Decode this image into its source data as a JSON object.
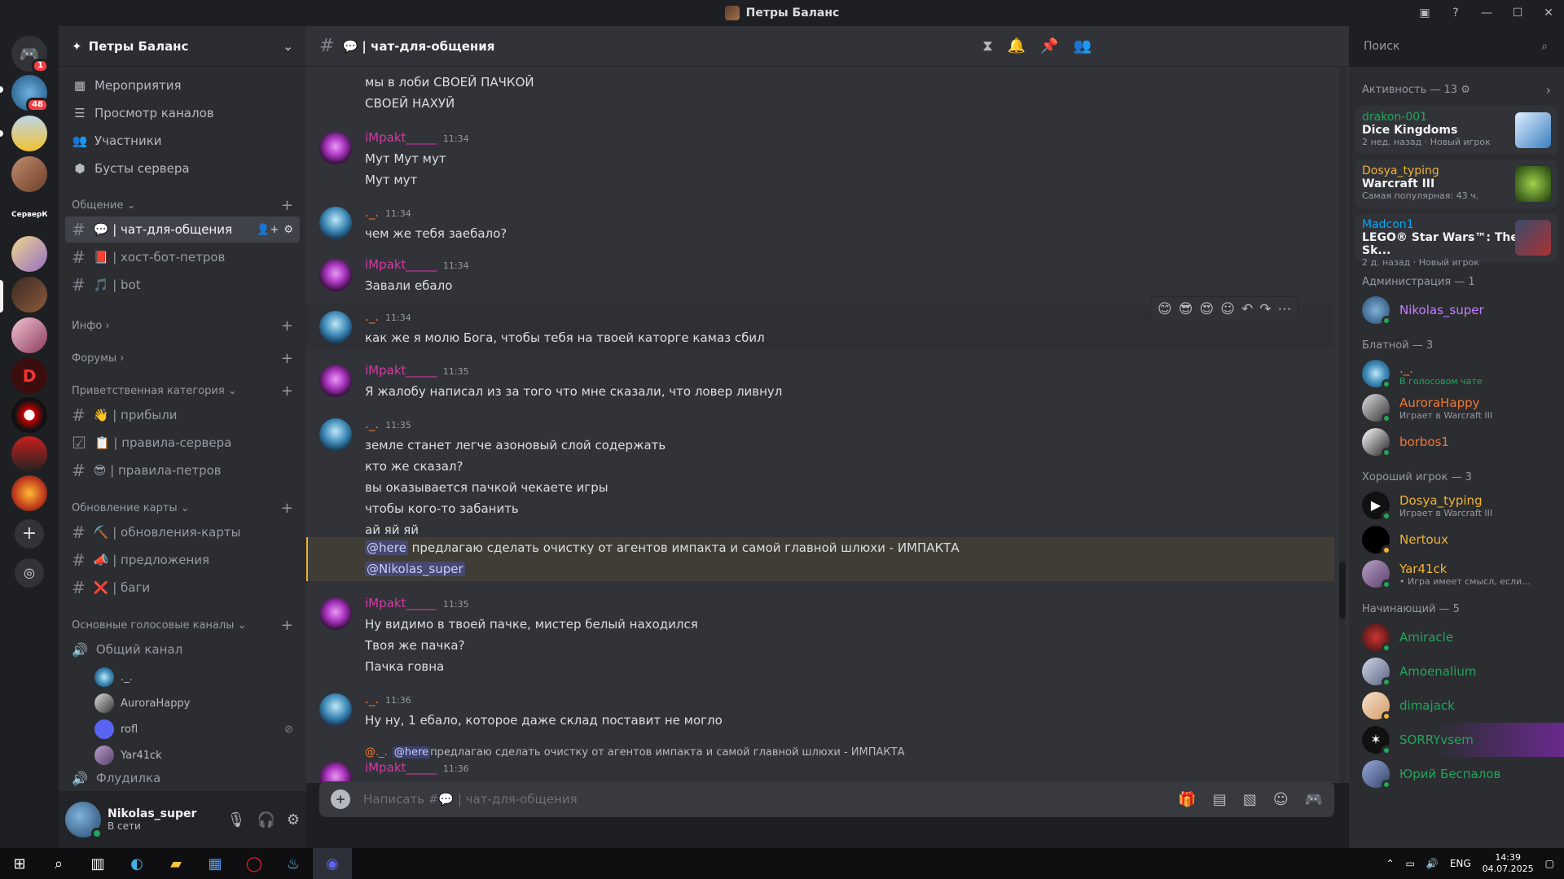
{
  "window": {
    "title": "Петры Баланс"
  },
  "guilds": {
    "home_badge": "1",
    "second_badge": "48",
    "server_text": "СерверК"
  },
  "server": {
    "name": "Петры Баланс",
    "nav": [
      "Мероприятия",
      "Просмотр каналов",
      "Участники",
      "Бусты сервера"
    ],
    "categories": {
      "obshenie": "Общение",
      "info": "Инфо",
      "forums": "Форумы",
      "welcome": "Приветственная категория",
      "update": "Обновление карты",
      "voice": "Основные голосовые каналы",
      "cut": "Флудилка"
    },
    "channels": {
      "chat": "💬 | чат-для-общения",
      "host": "📕 | хост-бот-петров",
      "bot": "🎵 | bot",
      "arrive": "👋 | прибыли",
      "rules_srv": "📋 | правила-сервера",
      "rules_pet": "😎 | правила-петров",
      "map_upd": "⛏️ | обновления-карты",
      "suggest": "📣 | предложения",
      "bugs": "❌ | баги",
      "voice_main": "Общий канал"
    },
    "voice_users": [
      "._.",
      "AuroraHappy",
      "rofl",
      "Yar41ck"
    ]
  },
  "user": {
    "name": "Nikolas_super",
    "status": "В сети"
  },
  "chat": {
    "header": "💬 | чат-для-общения",
    "search_placeholder": "Поиск",
    "composer_placeholder": "Написать #💬 | чат-для-общения",
    "messages": [
      {
        "lines": [
          "мы в лоби СВОЕЙ ПАЧКОЙ",
          "СВОЕЙ НАХУЙ"
        ]
      },
      {
        "user": "iMpakt_____",
        "time": "11:34",
        "lines": [
          "Мут Мут мут",
          "Мут мут"
        ]
      },
      {
        "user": "._.",
        "time": "11:34",
        "lines": [
          "чем же тебя заебало?"
        ]
      },
      {
        "user": "iMpakt_____",
        "time": "11:34",
        "lines": [
          "Завали ебало"
        ]
      },
      {
        "user": "._.",
        "time": "11:34",
        "lines": [
          "как же я молю Бога, чтобы тебя на твоей каторге камаз сбил"
        ]
      },
      {
        "user": "iMpakt_____",
        "time": "11:35",
        "lines": [
          "Я жалобу написал из за того что мне сказали, что ловер ливнул"
        ]
      },
      {
        "user": "._.",
        "time": "11:35",
        "lines": [
          "земле станет легче азоновый слой содержать",
          "кто же сказал?",
          "вы оказывается пачкой чекаете игры",
          "чтобы кого-то забанить",
          "ай яй яй"
        ]
      },
      {
        "mention1": "@here",
        "text1": " предлагаю сделать очистку от агентов импакта и самой главной шлюхи - ИМПАКТА",
        "mention2": "@Nikolas_super"
      },
      {
        "user": "iMpakt_____",
        "time": "11:35",
        "lines": [
          "Ну видимо в твоей пачке, мистер белый находился",
          "Твоя же пачка?",
          "Пачка говна"
        ]
      },
      {
        "user": "._.",
        "time": "11:36",
        "lines": [
          "Ну ну, 1 ебало, которое даже склад поставит не могло"
        ]
      },
      {
        "reply_user": "@._.",
        "reply_mention": "@here",
        "reply_text": " предлагаю сделать очистку от агентов импакта и самой главной шлюхи - ИМПАКТА",
        "user": "iMpakt_____",
        "time": "11:36"
      }
    ]
  },
  "members": {
    "activity_title": "Активность — 13",
    "activities": [
      {
        "user": "drakon-001",
        "game": "Dice Kingdoms",
        "meta": "2 нед. назад",
        "tag": "Новый игрок"
      },
      {
        "user": "Dosya_typing",
        "game": "Warcraft III",
        "meta": "Самая популярная: 43 ч."
      },
      {
        "user": "Madcon1",
        "game": "LEGO® Star Wars™: The Sk...",
        "meta": "2 д. назад",
        "tag": "Новый игрок"
      }
    ],
    "groups": [
      {
        "title": "Администрация — 1",
        "users": [
          {
            "name": "Nikolas_super",
            "color": "#c77dff"
          }
        ]
      },
      {
        "title": "Блатной — 3",
        "users": [
          {
            "name": "._.",
            "sub": "В голосовом чате",
            "color": "#f57731"
          },
          {
            "name": "AuroraHappy",
            "sub": "Играет в Warcraft III",
            "color": "#f57731"
          },
          {
            "name": "borbos1",
            "color": "#f57731"
          }
        ]
      },
      {
        "title": "Хороший игрок — 3",
        "users": [
          {
            "name": "Dosya_typing",
            "sub": "Играет в Warcraft III",
            "color": "#f0b232"
          },
          {
            "name": "Nertoux",
            "color": "#f0b232"
          },
          {
            "name": "Yar41ck",
            "sub": "• Игра имеет смысл, если...",
            "color": "#f0b232"
          }
        ]
      },
      {
        "title": "Начинающий — 5",
        "users": [
          {
            "name": "Amiracle",
            "color": "#23a55a"
          },
          {
            "name": "Amoenalium",
            "color": "#23a55a"
          },
          {
            "name": "dimajack",
            "color": "#23a55a"
          },
          {
            "name": "SORRYvsem",
            "color": "#23a55a"
          },
          {
            "name": "Юрий Беспалов",
            "color": "#23a55a"
          }
        ]
      }
    ]
  },
  "taskbar": {
    "lang": "ENG",
    "time": "14:39",
    "date": "04.07.2025"
  }
}
